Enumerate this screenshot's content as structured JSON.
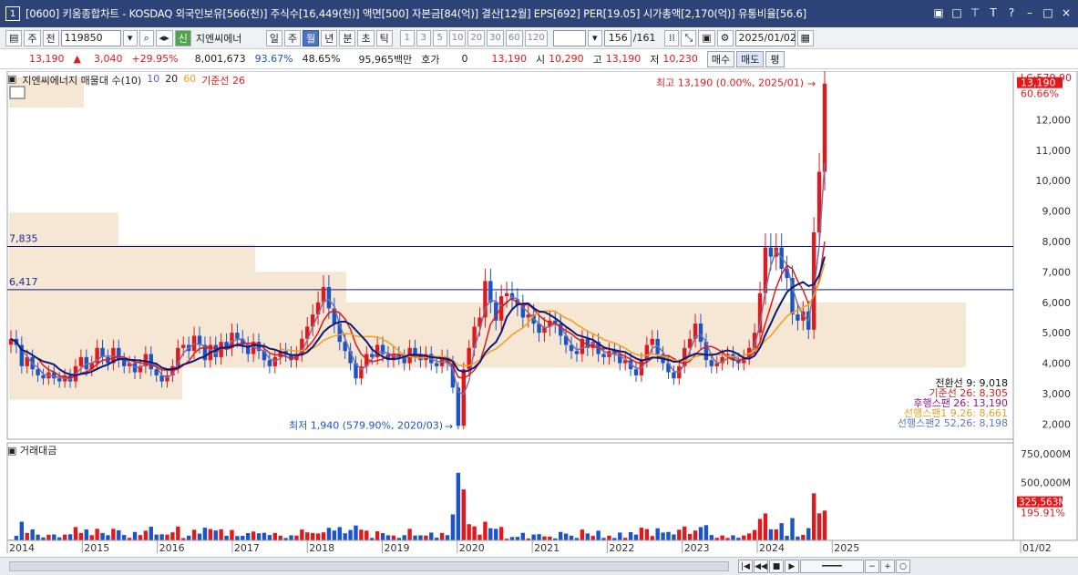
{
  "window": {
    "number_badge": "1",
    "title": "[0600] 키움종합차트 - KOSDAQ 외국인보유[566(천)] 주식수[16,449(천)] 액면[500] 자본금[84(억)] 결산[12월] EPS[692] PER[19.05] 시가총액[2,170(억)] 유통비율[56.6]",
    "controls": [
      "▣",
      "□",
      "⊤",
      "T",
      "?",
      "–",
      "□",
      "×"
    ]
  },
  "toolbar": {
    "period_select": "주",
    "mode": "전",
    "code": "119850",
    "name": "지엔씨에너",
    "badge": "신",
    "periods": [
      "일",
      "주",
      "월",
      "년"
    ],
    "selected_period": "월",
    "intervals": [
      "분",
      "초",
      "틱"
    ],
    "numbers": [
      "1",
      "3",
      "5",
      "10",
      "20",
      "30",
      "60",
      "120"
    ],
    "count": "156",
    "total": "/161",
    "date": "2025/01/02"
  },
  "quote": {
    "price": "13,190",
    "change": "3,040",
    "change_pct": "+29.95%",
    "volume": "8,001,673",
    "vol_ratio": "93.67%",
    "turnover": "48.65%",
    "amount": "95,965백만",
    "hoga_label": "호가",
    "hoga_value": "0",
    "cur_price": "13,190",
    "open_label": "시",
    "open": "10,290",
    "high_label": "고",
    "high": "13,190",
    "low_label": "저",
    "low": "10,230",
    "buy_label": "매수",
    "sell_label": "매도",
    "flat_label": "평"
  },
  "legend": {
    "name": "지엔씨에너지 매물대 수(10)",
    "ma10": "10",
    "ma20": "20",
    "ma60": "60",
    "base": "기준선 26"
  },
  "volume_legend": "거래대금",
  "annotations": {
    "high": "최고 13,190 (0.00%, 2025/01)",
    "low": "최저 1,940 (579.90%, 2020/03)",
    "line1": "7,835",
    "line2": "6,417"
  },
  "right_labels": {
    "top": "LC:579.90",
    "price": "13,190",
    "pct": "60.66%",
    "vol_price": "325,563M",
    "vol_pct": "195.91%"
  },
  "ichimoku": [
    "전환선 9: 9,018",
    "기준선 26: 8,305",
    "후행스팬 26: 13,190",
    "선행스팬1 9,26: 8,661",
    "선행스팬2 52,26: 8,198"
  ],
  "x_labels": [
    "2014",
    "2015",
    "2016",
    "2017",
    "2018",
    "2019",
    "2020",
    "2021",
    "2022",
    "2023",
    "2024",
    "2025",
    "01/02"
  ],
  "colors": {
    "up": "#e0191d",
    "down": "#1a54c8",
    "ma10": "#7a6fa6",
    "ma20": "#e0191d",
    "ma60": "#f0a020",
    "base": "#0b1a7a",
    "volume_bg": "#f6e6d4"
  },
  "chart_data": {
    "type": "candlestick",
    "y_ticks": [
      2000,
      3000,
      4000,
      5000,
      6000,
      7000,
      8000,
      9000,
      10000,
      11000,
      12000
    ],
    "ylim": [
      1500,
      13600
    ],
    "vol_ticks": [
      "500,000M",
      "750,000M"
    ],
    "horizontal_lines": [
      7835,
      6417
    ],
    "closes": [
      4800,
      4600,
      3900,
      4200,
      3800,
      3600,
      3500,
      3700,
      3500,
      3400,
      3600,
      3400,
      3900,
      4200,
      3800,
      4000,
      4500,
      4200,
      4000,
      4500,
      4100,
      3900,
      4000,
      3700,
      3900,
      4300,
      3800,
      3600,
      3400,
      3600,
      3900,
      4500,
      4600,
      4400,
      4900,
      4600,
      4100,
      4600,
      4200,
      4700,
      4500,
      5000,
      4800,
      4600,
      4300,
      4700,
      4400,
      4100,
      3900,
      4200,
      4400,
      4300,
      4100,
      4300,
      4800,
      5200,
      5600,
      6000,
      6500,
      5800,
      5300,
      4700,
      4400,
      4000,
      3500,
      3900,
      4300,
      4200,
      4600,
      4300,
      4100,
      4300,
      4200,
      4000,
      4500,
      4300,
      4100,
      4300,
      4000,
      3900,
      4200,
      4000,
      3200,
      1940,
      3800,
      4500,
      5200,
      5500,
      6700,
      6000,
      5400,
      6200,
      6300,
      6100,
      5900,
      5500,
      5600,
      5300,
      5000,
      5200,
      5400,
      5300,
      4900,
      4600,
      4400,
      4300,
      4800,
      4500,
      4700,
      4300,
      4200,
      4400,
      4300,
      4000,
      4100,
      3800,
      3600,
      4100,
      4600,
      4800,
      4300,
      4000,
      3700,
      3500,
      3900,
      4500,
      4800,
      5300,
      4700,
      4100,
      3900,
      4000,
      4200,
      4300,
      4100,
      4000,
      4200,
      4500,
      5000,
      6300,
      7800,
      7500,
      7800,
      7100,
      6800,
      5600,
      5400,
      5700,
      5100,
      8300,
      10290,
      13190
    ]
  }
}
